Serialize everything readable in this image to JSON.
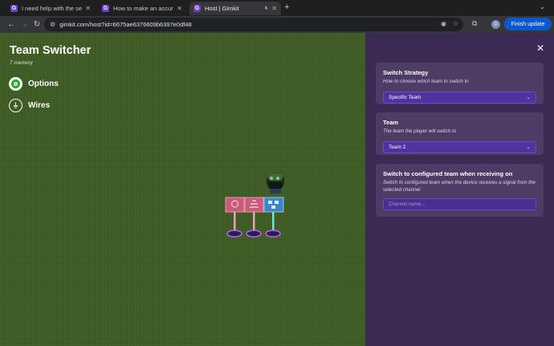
{
  "browser": {
    "tabs": [
      {
        "title": "I need help with the seconde",
        "favicon": "G",
        "active": false
      },
      {
        "title": "How to make an accurate \"se",
        "favicon": "G",
        "active": false
      },
      {
        "title": "Host | Gimkit",
        "favicon": "G",
        "active": true
      }
    ],
    "url": "gimkit.com/host?id=6675ae6376609b6397e0df48",
    "profile_initial": "D",
    "finish_update_label": "Finish update",
    "icons": [
      "back-icon",
      "forward-icon",
      "reload-icon",
      "site-info-icon",
      "eye-off-icon",
      "bookmark-star-icon",
      "extensions-icon",
      "kebab-menu-icon"
    ]
  },
  "device": {
    "title": "Team Switcher",
    "memory": "7 memory",
    "options_label": "Options",
    "wires_label": "Wires"
  },
  "panel": {
    "sections": [
      {
        "heading": "Switch Strategy",
        "description": "How to choose which team to switch to",
        "value": "Specific Team"
      },
      {
        "heading": "Team",
        "description": "The team the player will switch to",
        "value": "Team 2"
      },
      {
        "heading": "Switch to configured team when receiving on",
        "description": "Switch to configured team when the device receives a signal from the selected channel",
        "placeholder": "Channel name..."
      }
    ]
  },
  "colors": {
    "game_background": "#3f5d24",
    "panel_background": "#3c2a55",
    "card_background": "#4e3c66",
    "select_background": "#5232a0",
    "finish_button": "#0b57d0"
  }
}
